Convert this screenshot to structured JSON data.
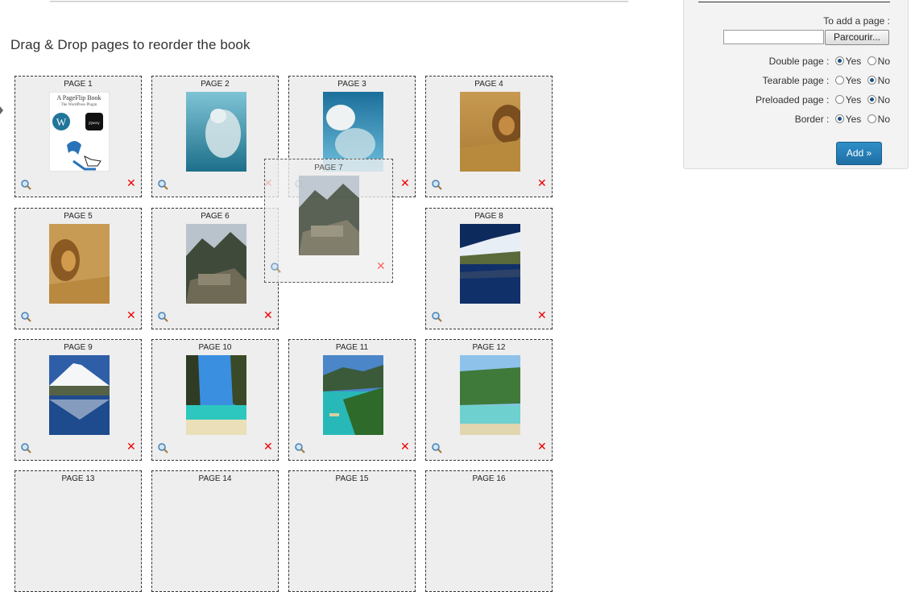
{
  "page_heading": "Drag & Drop pages to reorder the book",
  "panel": {
    "add_page_label": "To add a page :",
    "file_value": "",
    "browse_label": "Parcourir...",
    "options": [
      {
        "label": "Double page :",
        "selected": "Yes"
      },
      {
        "label": "Tearable page :",
        "selected": "No"
      },
      {
        "label": "Preloaded page :",
        "selected": "No"
      },
      {
        "label": "Border :",
        "selected": "Yes"
      }
    ],
    "yes_label": "Yes",
    "no_label": "No",
    "add_button": "Add »"
  },
  "pages": [
    {
      "label": "PAGE 1",
      "image": "pageflip-book-cover"
    },
    {
      "label": "PAGE 2",
      "image": "polar-bear-underwater"
    },
    {
      "label": "PAGE 3",
      "image": "polar-bear-swimming"
    },
    {
      "label": "PAGE 4",
      "image": "lion-in-grass"
    },
    {
      "label": "PAGE 5",
      "image": "lion-profile"
    },
    {
      "label": "PAGE 6",
      "image": "machu-picchu"
    },
    {
      "label": "PAGE 8",
      "image": "mountain-lake-reflection"
    },
    {
      "label": "PAGE 9",
      "image": "snowy-volcano-reflection"
    },
    {
      "label": "PAGE 10",
      "image": "tropical-cove"
    },
    {
      "label": "PAGE 11",
      "image": "tropical-beach-boat"
    },
    {
      "label": "PAGE 12",
      "image": "palm-beach"
    },
    {
      "label": "PAGE 13",
      "image": ""
    },
    {
      "label": "PAGE 14",
      "image": ""
    },
    {
      "label": "PAGE 15",
      "image": ""
    },
    {
      "label": "PAGE 16",
      "image": ""
    }
  ],
  "dragging": {
    "label": "PAGE 7",
    "image": "machu-picchu"
  },
  "book_cover": {
    "title": "A PageFlip Book",
    "subtitle": "The WordPress Plugin",
    "jquery_badge": "jQuery"
  },
  "colors": {
    "delete": "#e00000",
    "add_button": "#2478b0",
    "card_bg": "#eeeeee"
  }
}
